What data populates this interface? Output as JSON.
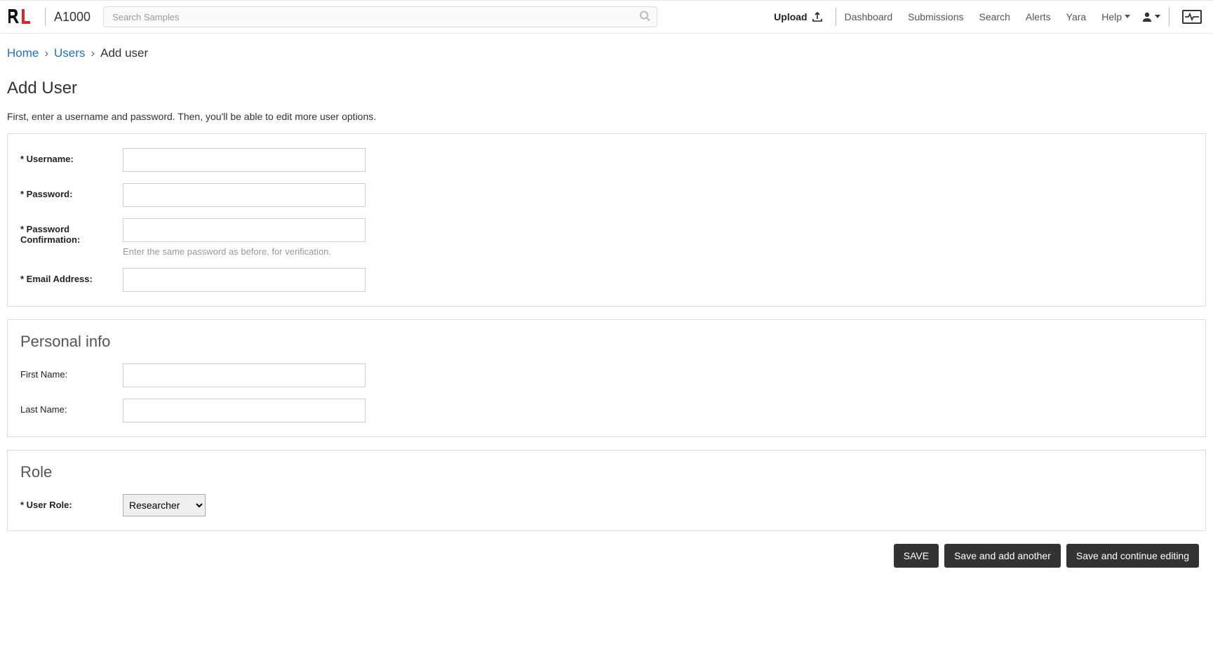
{
  "header": {
    "app_name": "A1000",
    "search_placeholder": "Search Samples",
    "upload_label": "Upload",
    "nav": {
      "dashboard": "Dashboard",
      "submissions": "Submissions",
      "search": "Search",
      "alerts": "Alerts",
      "yara": "Yara",
      "help": "Help"
    }
  },
  "breadcrumb": {
    "home": "Home",
    "users": "Users",
    "current": "Add user",
    "sep": "›"
  },
  "page": {
    "title": "Add User",
    "description": "First, enter a username and password. Then, you'll be able to edit more user options."
  },
  "form": {
    "username_label": "* Username:",
    "password_label": "* Password:",
    "password_confirm_label": "* Password Confirmation:",
    "password_confirm_help": "Enter the same password as before, for verification.",
    "email_label": "* Email Address:",
    "personal_info_title": "Personal info",
    "first_name_label": "First Name:",
    "last_name_label": "Last Name:",
    "role_title": "Role",
    "user_role_label": "* User Role:",
    "user_role_value": "Researcher"
  },
  "actions": {
    "save": "SAVE",
    "save_add_another": "Save and add another",
    "save_continue": "Save and continue editing"
  }
}
